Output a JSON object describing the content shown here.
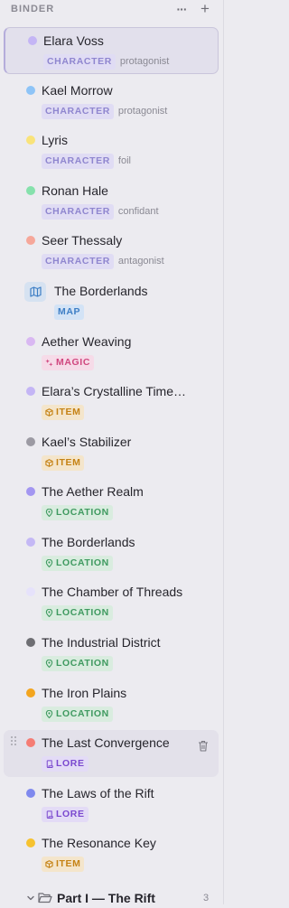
{
  "binder": {
    "title": "BINDER",
    "more_label": "···",
    "add_label": "+"
  },
  "items": [
    {
      "name": "Elara Voss",
      "tag": "CHARACTER",
      "role": "protagonist",
      "color": "#c4b5f5"
    },
    {
      "name": "Kael Morrow",
      "tag": "CHARACTER",
      "role": "protagonist",
      "color": "#8ec4f7"
    },
    {
      "name": "Lyris",
      "tag": "CHARACTER",
      "role": "foil",
      "color": "#f9e37a"
    },
    {
      "name": "Ronan Hale",
      "tag": "CHARACTER",
      "role": "confidant",
      "color": "#86e1ac"
    },
    {
      "name": "Seer Thessaly",
      "tag": "CHARACTER",
      "role": "antagonist",
      "color": "#f6a79a"
    },
    {
      "name": "The Borderlands",
      "tag": "MAP",
      "icon": "map-icon"
    },
    {
      "name": "Aether Weaving",
      "tag": "MAGIC",
      "color": "#d9b8f2",
      "tag_icon": "sparkle-icon"
    },
    {
      "name": "Elara’s Crystalline Time…",
      "tag": "ITEM",
      "color": "#c4b5f5",
      "tag_icon": "box-icon"
    },
    {
      "name": "Kael’s Stabilizer",
      "tag": "ITEM",
      "color": "#9c9aa3",
      "tag_icon": "box-icon"
    },
    {
      "name": "The Aether Realm",
      "tag": "LOCATION",
      "color": "#a396f1",
      "tag_icon": "pin-icon"
    },
    {
      "name": "The Borderlands",
      "tag": "LOCATION",
      "color": "#c4b8f5",
      "tag_icon": "pin-icon"
    },
    {
      "name": "The Chamber of Threads",
      "tag": "LOCATION",
      "color": "#e6e2fb",
      "tag_icon": "pin-icon"
    },
    {
      "name": "The Industrial District",
      "tag": "LOCATION",
      "color": "#6e6e73",
      "tag_icon": "pin-icon"
    },
    {
      "name": "The Iron Plains",
      "tag": "LOCATION",
      "color": "#f3a51f",
      "tag_icon": "pin-icon"
    },
    {
      "name": "The Last Convergence",
      "tag": "LORE",
      "color": "#f57c74",
      "tag_icon": "scroll-icon"
    },
    {
      "name": "The Laws of the Rift",
      "tag": "LORE",
      "color": "#7f89ee",
      "tag_icon": "scroll-icon"
    },
    {
      "name": "The Resonance Key",
      "tag": "ITEM",
      "color": "#f6c230",
      "tag_icon": "box-icon"
    }
  ],
  "folder": {
    "name": "Part I — The Rift",
    "count": "3"
  }
}
